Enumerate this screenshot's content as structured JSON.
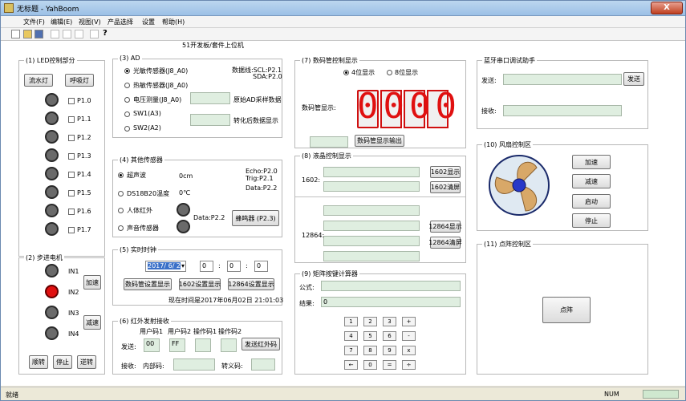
{
  "window": {
    "title": "无标题 - YahBoom",
    "close": "X"
  },
  "menu": [
    "文件(F)",
    "编辑(E)",
    "视图(V)",
    "产品选择",
    "设置",
    "帮助(H)"
  ],
  "header": "51开发板/套件上位机",
  "led": {
    "title": "(1) LED控制部分",
    "btn_flow": "流水灯",
    "btn_breath": "呼吸灯",
    "items": [
      "P1.0",
      "P1.1",
      "P1.2",
      "P1.3",
      "P1.4",
      "P1.5",
      "P1.6",
      "P1.7"
    ]
  },
  "ad": {
    "title": "(3) AD",
    "opts": [
      "光敏传感器(J8_A0)",
      "热敏传感器(J8_A0)",
      "电压测量(J8_A0)",
      "SW1(A3)",
      "SW2(A2)"
    ],
    "dataline": "数据线:SCL:P2.1",
    "sda": "SDA:P2.0",
    "raw_label": "原始AD采样数据",
    "conv_label": "转化后数据显示"
  },
  "other": {
    "title": "(4) 其他传感器",
    "opts": [
      "超声波",
      "DS18B20温度",
      "人体红外",
      "声音传感器"
    ],
    "cm": "0cm",
    "temp": "0℃",
    "echo": "Echo:P2.0",
    "trig": "Trig:P2.1",
    "data1": "Data:P2.2",
    "data2": "Data:P2.2",
    "buzzer": "蜂鸣器 (P2.3)"
  },
  "rtc": {
    "title": "(5) 实时时钟",
    "date": "2017/ 6/ 2",
    "h": "0",
    "m": "0",
    "s": "0",
    "b1": "数码管设置显示",
    "b2": "1602设置显示",
    "b3": "12864设置显示",
    "now": "现在时间是2017年06月02日 21:01:03"
  },
  "ir": {
    "title": "(6) 红外发射接收",
    "hdr": [
      "用户码1",
      "用户码2",
      "操作码1",
      "操作码2"
    ],
    "send_label": "发送:",
    "v1": "00",
    "v2": "FF",
    "send_btn": "发送红外码",
    "recv_label": "接收:",
    "inner": "内部码:",
    "trans": "转义码:"
  },
  "stepper": {
    "title": "(2) 步进电机",
    "ins": [
      "IN1",
      "IN2",
      "IN3",
      "IN4"
    ],
    "acc": "加速",
    "dec": "减速",
    "cw": "顺转",
    "stop": "停止",
    "ccw": "逆转"
  },
  "seg": {
    "title": "(7) 数码管控制显示",
    "r4": "4位显示",
    "r8": "8位显示",
    "label": "数码管显示:",
    "digits": "0000",
    "out": "数码管显示输出"
  },
  "lcd": {
    "title": "(8) 液晶控制显示",
    "l1602": "1602:",
    "b1602s": "1602显示",
    "b1602c": "1602清屏",
    "l12864": "12864:",
    "b12864s": "12864显示",
    "b12864c": "12864清屏"
  },
  "calc": {
    "title": "(9) 矩阵按键计算器",
    "formula": "公式:",
    "result": "结果:",
    "result_val": "0",
    "keys": [
      "1",
      "2",
      "3",
      "+",
      "4",
      "5",
      "6",
      "-",
      "7",
      "8",
      "9",
      "x",
      "←",
      "0",
      "=",
      "÷"
    ]
  },
  "bt": {
    "title": "蓝牙串口调试助手",
    "send": "发送:",
    "send_btn": "发送",
    "recv": "接收:"
  },
  "fan": {
    "title": "(10) 风扇控制区",
    "acc": "加速",
    "dec": "减速",
    "start": "启动",
    "stop": "停止"
  },
  "matrix": {
    "title": "(11) 点阵控制区",
    "btn": "点阵"
  },
  "status": {
    "ready": "就绪",
    "num": "NUM"
  }
}
